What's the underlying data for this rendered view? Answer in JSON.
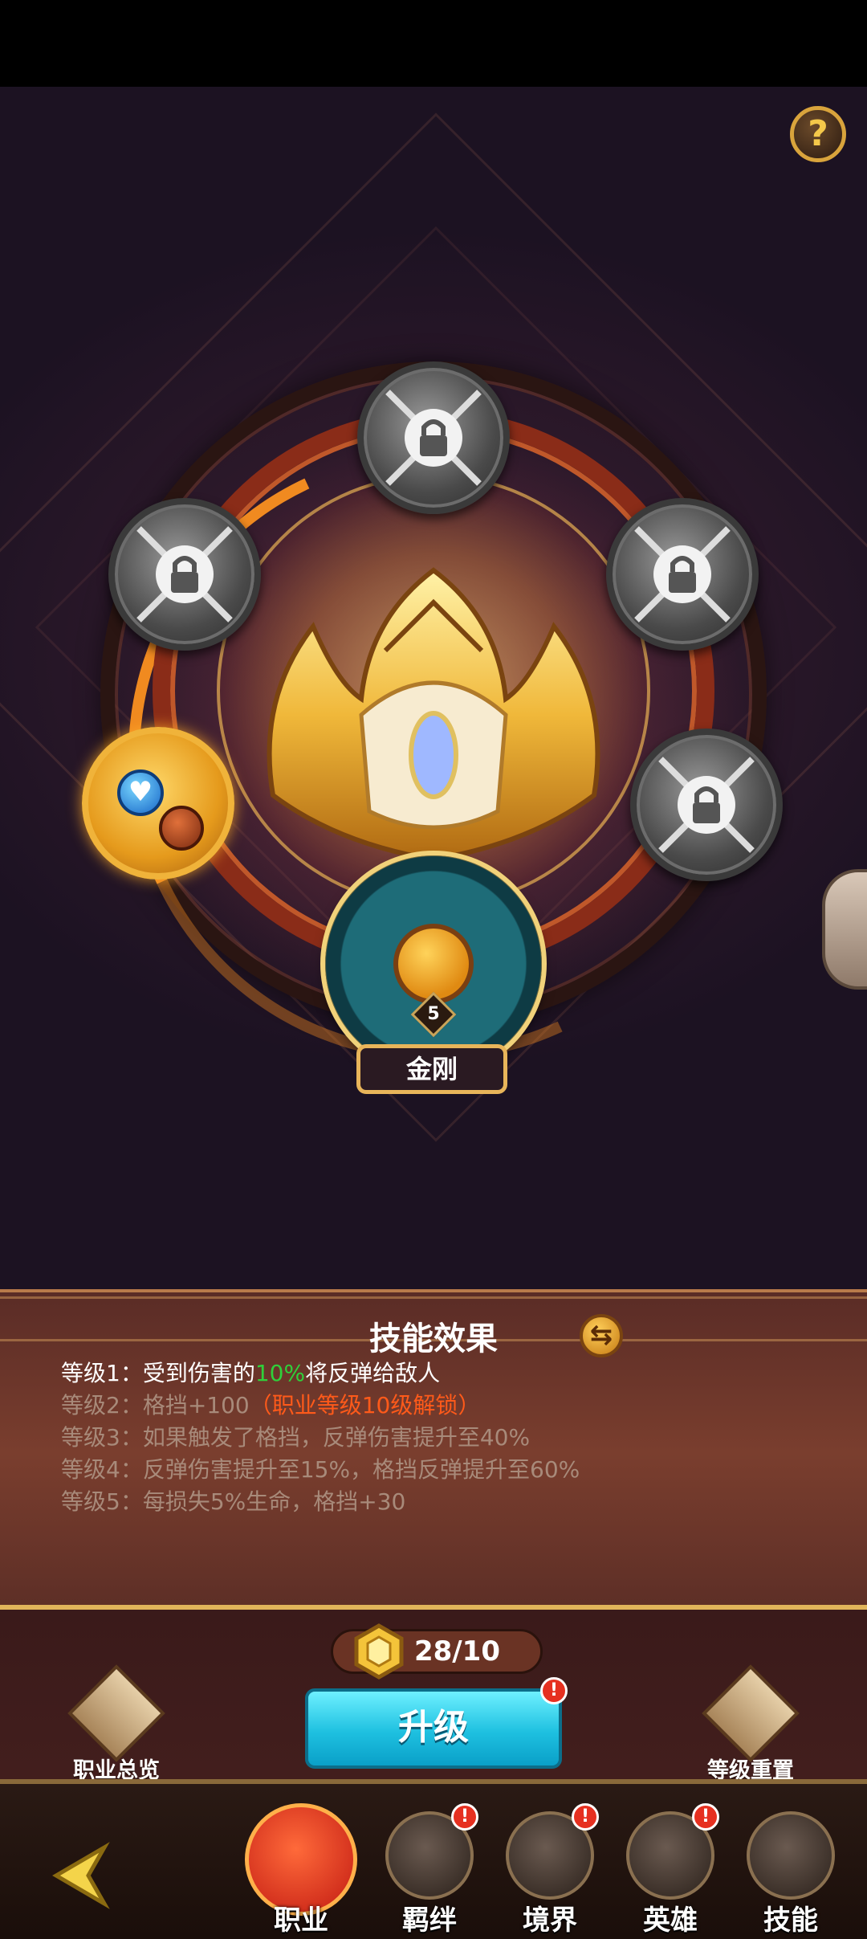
{
  "colors": {
    "accent_gold": "#e8b55a",
    "upgrade_cyan": "#1ec0e0",
    "highlight_green": "#2fd03a",
    "lock_note_orange": "#ff5a1a",
    "badge_red": "#e63020"
  },
  "header": {
    "help_label": "?"
  },
  "skill_tree": {
    "selected_skill": {
      "name": "金刚",
      "level": "5"
    },
    "nodes": [
      {
        "id": "top",
        "state": "locked",
        "icon": "lock-icon"
      },
      {
        "id": "upper-left",
        "state": "locked",
        "icon": "lock-icon"
      },
      {
        "id": "upper-right",
        "state": "locked",
        "icon": "lock-icon"
      },
      {
        "id": "right",
        "state": "locked",
        "icon": "lock-icon"
      },
      {
        "id": "left",
        "state": "unlocked",
        "icon": "heart-fist-icon"
      }
    ]
  },
  "effects_panel": {
    "title": "技能效果",
    "levels": [
      {
        "prefix": "等级1：受到伤害的",
        "highlight": "10%",
        "suffix": "将反弹给敌人",
        "note": "",
        "active": true
      },
      {
        "prefix": "等级2：格挡+100",
        "highlight": "",
        "suffix": "",
        "note": "（职业等级10级解锁）",
        "active": false
      },
      {
        "prefix": "等级3：如果触发了格挡，反弹伤害提升至40%",
        "highlight": "",
        "suffix": "",
        "note": "",
        "active": false
      },
      {
        "prefix": "等级4：反弹伤害提升至15%，格挡反弹提升至60%",
        "highlight": "",
        "suffix": "",
        "note": "",
        "active": false
      },
      {
        "prefix": "等级5：每损失5%生命，格挡+30",
        "highlight": "",
        "suffix": "",
        "note": "",
        "active": false
      }
    ]
  },
  "upgrade": {
    "currency": "28/10",
    "button_label": "升级",
    "badge": "!",
    "overview_label": "职业总览",
    "reset_label": "等级重置"
  },
  "nav": [
    {
      "label": "职业",
      "icon": "book-icon",
      "active": true,
      "badge": ""
    },
    {
      "label": "羁绊",
      "icon": "bond-icon",
      "active": false,
      "badge": "!"
    },
    {
      "label": "境界",
      "icon": "realm-icon",
      "active": false,
      "badge": "!"
    },
    {
      "label": "英雄",
      "icon": "hero-icon",
      "active": false,
      "badge": "!"
    },
    {
      "label": "技能",
      "icon": "skill-icon",
      "active": false,
      "badge": ""
    }
  ]
}
